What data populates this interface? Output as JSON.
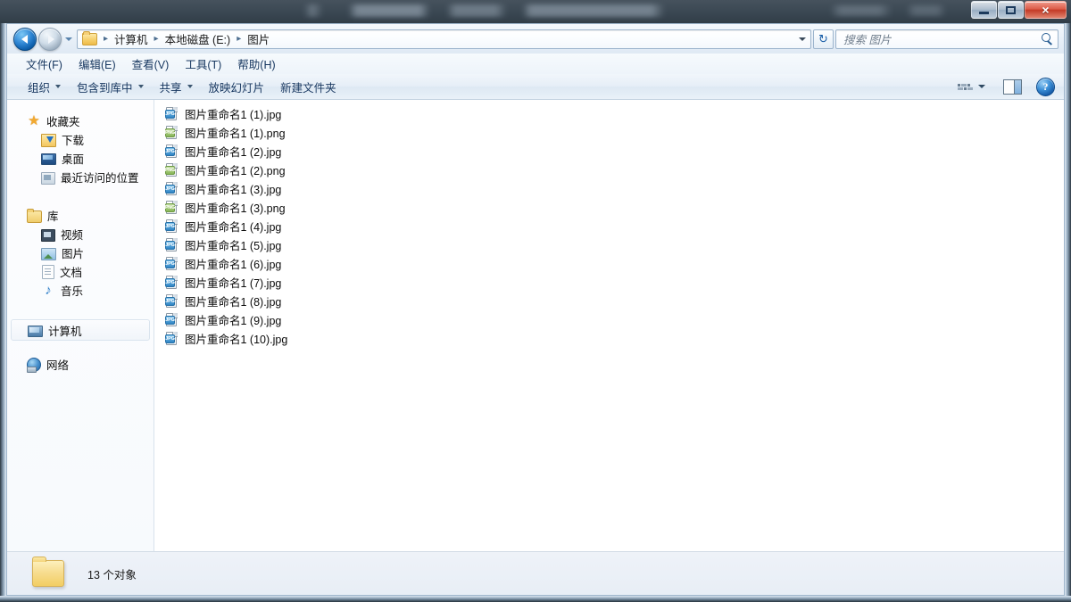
{
  "window": {
    "caption_buttons": {
      "minimize": "minimize-button",
      "maximize": "maximize-button",
      "close": "×"
    }
  },
  "addressbar": {
    "back_tooltip": "后退",
    "forward_tooltip": "前进",
    "breadcrumbs": [
      "计算机",
      "本地磁盘 (E:)",
      "图片"
    ],
    "separator": "▸",
    "refresh_glyph": "↻",
    "search": {
      "placeholder": "搜索 图片",
      "value": ""
    }
  },
  "menubar": {
    "items": [
      {
        "label": "文件(F)"
      },
      {
        "label": "编辑(E)"
      },
      {
        "label": "查看(V)"
      },
      {
        "label": "工具(T)"
      },
      {
        "label": "帮助(H)"
      }
    ]
  },
  "toolbar": {
    "items": [
      {
        "label": "组织",
        "has_caret": true
      },
      {
        "label": "包含到库中",
        "has_caret": true
      },
      {
        "label": "共享",
        "has_caret": true
      },
      {
        "label": "放映幻灯片",
        "has_caret": false
      },
      {
        "label": "新建文件夹",
        "has_caret": false
      }
    ],
    "help_label": "?"
  },
  "sidebar": {
    "groups": [
      {
        "header": {
          "label": "收藏夹",
          "icon": "star-icon"
        },
        "items": [
          {
            "label": "下载",
            "icon": "download-icon"
          },
          {
            "label": "桌面",
            "icon": "desktop-icon"
          },
          {
            "label": "最近访问的位置",
            "icon": "recent-places-icon"
          }
        ]
      },
      {
        "header": {
          "label": "库",
          "icon": "library-icon"
        },
        "items": [
          {
            "label": "视频",
            "icon": "video-icon"
          },
          {
            "label": "图片",
            "icon": "picture-icon"
          },
          {
            "label": "文档",
            "icon": "document-icon"
          },
          {
            "label": "音乐",
            "icon": "music-icon"
          }
        ]
      }
    ],
    "computer": {
      "label": "计算机",
      "icon": "computer-icon",
      "selected": true
    },
    "network": {
      "label": "网络",
      "icon": "network-icon"
    }
  },
  "filelist": {
    "files": [
      {
        "name": "图片重命名1 (1).jpg",
        "type": "jpg",
        "badge": "JPG"
      },
      {
        "name": "图片重命名1 (1).png",
        "type": "png",
        "badge": "PNG"
      },
      {
        "name": "图片重命名1 (2).jpg",
        "type": "jpg",
        "badge": "JPG"
      },
      {
        "name": "图片重命名1 (2).png",
        "type": "png",
        "badge": "PNG"
      },
      {
        "name": "图片重命名1 (3).jpg",
        "type": "jpg",
        "badge": "JPG"
      },
      {
        "name": "图片重命名1 (3).png",
        "type": "png",
        "badge": "PNG"
      },
      {
        "name": "图片重命名1 (4).jpg",
        "type": "jpg",
        "badge": "JPG"
      },
      {
        "name": "图片重命名1 (5).jpg",
        "type": "jpg",
        "badge": "JPG"
      },
      {
        "name": "图片重命名1 (6).jpg",
        "type": "jpg",
        "badge": "JPG"
      },
      {
        "name": "图片重命名1 (7).jpg",
        "type": "jpg",
        "badge": "JPG"
      },
      {
        "name": "图片重命名1 (8).jpg",
        "type": "jpg",
        "badge": "JPG"
      },
      {
        "name": "图片重命名1 (9).jpg",
        "type": "jpg",
        "badge": "JPG"
      },
      {
        "name": "图片重命名1 (10).jpg",
        "type": "jpg",
        "badge": "JPG"
      }
    ]
  },
  "statusbar": {
    "text": "13 个对象"
  },
  "colors": {
    "accent": "#16365f",
    "jpg_badge": "#2f84c4",
    "png_badge": "#87b558",
    "close_button": "#c33a26"
  }
}
